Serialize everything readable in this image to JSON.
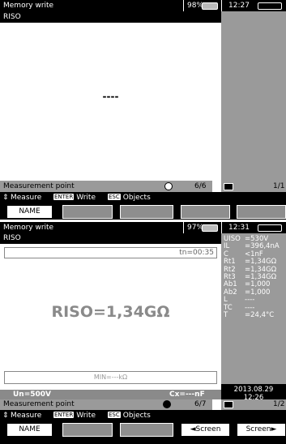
{
  "screen1": {
    "title": "Memory write",
    "battery": "98%",
    "time": "12:27",
    "header_param": "RISO",
    "value": "----",
    "measurement_point_label": "Measurement point",
    "point_count": "6/6",
    "page": "1/1",
    "hint_measure": "Measure",
    "hint_enter": "ENTER",
    "hint_write": "Write",
    "hint_esc": "ESC",
    "hint_objects": "Objects",
    "fkeys": [
      "NAME",
      "",
      "",
      "",
      ""
    ]
  },
  "screen2": {
    "title": "Memory write",
    "battery": "97%",
    "time": "12:31",
    "header_param": "RISO",
    "tn": "tn=00:35",
    "result": "RISO=1,34GΩ",
    "min": "MIN=---kΩ",
    "un": "Un=500V",
    "cx": "Cx=---nF",
    "date": "2013.08.29",
    "clock": "12:26",
    "measurement_point_label": "Measurement point",
    "point_count": "6/7",
    "page": "1/2",
    "hint_measure": "Measure",
    "hint_enter": "ENTER",
    "hint_write": "Write",
    "hint_esc": "ESC",
    "hint_objects": "Objects",
    "fkeys": [
      "NAME",
      "",
      "",
      "◄Screen",
      "Screen►"
    ],
    "params": [
      {
        "label": "UISO",
        "value": "=530V"
      },
      {
        "label": "IL",
        "value": "=396,4nA"
      },
      {
        "label": "C",
        "value": "<1nF"
      },
      {
        "label": "Rt1",
        "value": "=1,34GΩ"
      },
      {
        "label": "Rt2",
        "value": "=1,34GΩ"
      },
      {
        "label": "Rt3",
        "value": "=1,34GΩ"
      },
      {
        "label": "Ab1",
        "value": "=1,000"
      },
      {
        "label": "Ab2",
        "value": "=1,000"
      },
      {
        "label": "L",
        "value": "----"
      },
      {
        "label": "TC",
        "value": "----"
      },
      {
        "label": "T",
        "value": "=24,4°C"
      }
    ]
  }
}
